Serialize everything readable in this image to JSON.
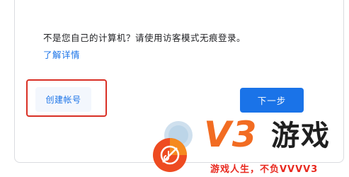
{
  "dialog": {
    "notice_text": "不是您自己的计算机？请使用访客模式无痕登录。",
    "learn_more_link": "了解详情",
    "create_account_button": "创建帐号",
    "next_button": "下一步"
  },
  "watermark": {
    "brand_v3": "V3",
    "brand_game": "游戏",
    "slogan": "游戏人生，不负VVVV3"
  },
  "colors": {
    "accent": "#1a73e8",
    "highlight_border": "#d93025",
    "watermark_orange": "#f26c22",
    "watermark_red": "#e8291f"
  }
}
